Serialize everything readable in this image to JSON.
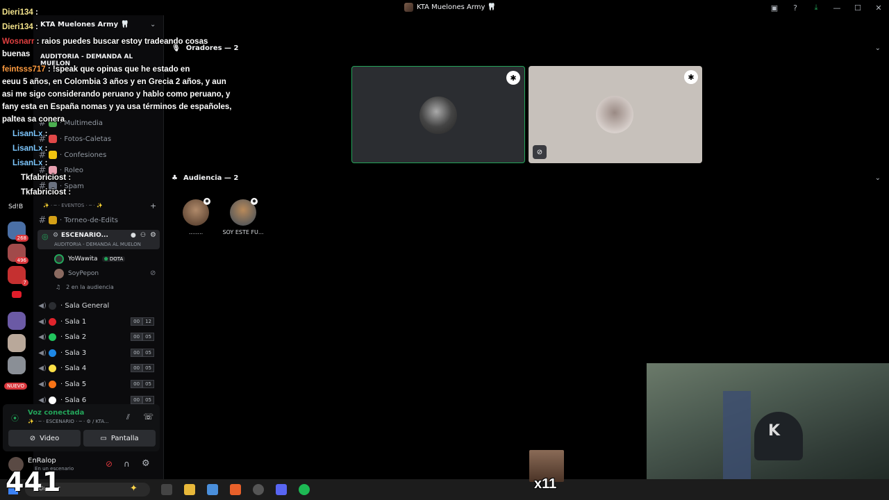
{
  "window": {
    "title": "KTA Muelones Army 🦷"
  },
  "server": {
    "name": "KTA Muelones Army 🦷"
  },
  "stage_topic_overlay": "AUDITORIA - DEMANDA AL MUELON",
  "channels": [
    {
      "name": "· Multimedia"
    },
    {
      "name": "· Fotos-Caletas"
    },
    {
      "name": "· Confesiones"
    },
    {
      "name": "· Roleo"
    },
    {
      "name": "· Spam"
    }
  ],
  "events_category": "✨ · ─ · EVENTOS · ─ · ✨",
  "torneo": "· Torneo-de-Edits",
  "stage_channel": {
    "name": "ESCENARIO...",
    "topic": "AUDITORIA - DEMANDA AL MUELON",
    "speakers": [
      {
        "name": "YoWawita",
        "tag": "DOTA"
      },
      {
        "name": "SoyPepon"
      }
    ],
    "audience_text": "2 en la audiencia"
  },
  "voice_channels": [
    {
      "name": "· Sala General",
      "color": "#2b2d31",
      "counts": null
    },
    {
      "name": "· Sala 1",
      "color": "#e0242c",
      "counts": [
        "00",
        "12"
      ]
    },
    {
      "name": "· Sala 2",
      "color": "#22c55e",
      "counts": [
        "00",
        "05"
      ]
    },
    {
      "name": "· Sala 3",
      "color": "#1e88e5",
      "counts": [
        "00",
        "05"
      ]
    },
    {
      "name": "· Sala 4",
      "color": "#fde047",
      "counts": [
        "00",
        "05"
      ]
    },
    {
      "name": "· Sala 5",
      "color": "#f97316",
      "counts": [
        "00",
        "05"
      ]
    },
    {
      "name": "· Sala 6",
      "color": "#ffffff",
      "counts": [
        "00",
        "05"
      ]
    }
  ],
  "voice_panel": {
    "status": "Voz conectada",
    "channel": "✨ · ─ · ESCENARIO · ─ · ⚙ / KTA...",
    "video_label": "Video",
    "screen_label": "Pantalla"
  },
  "user": {
    "name": "EnRalop",
    "status": "En un escenario"
  },
  "rail": {
    "label": "Sd!B",
    "badges": [
      "268",
      "496",
      "7"
    ],
    "new_label": "NUEVO"
  },
  "main": {
    "speakers_header": "Oradores — 2",
    "audience_header": "Audiencia — 2",
    "audience": [
      {
        "name": "........"
      },
      {
        "name": "SOY ESTE FU..."
      }
    ]
  },
  "chat": [
    {
      "user": "Dieri134",
      "text": "",
      "user_color": "yellow"
    },
    {
      "user": "Dieri134",
      "text": "",
      "user_color": "yellow"
    },
    {
      "user": "Wosnarr",
      "text": "raios puedes buscar estoy tradeando cosas",
      "user_color": "yellow"
    },
    {
      "user": "",
      "text": "buenas",
      "user_color": "white"
    },
    {
      "user": "feintsss717",
      "text": "!speak que opinas que he estado en",
      "user_color": "yellow"
    },
    {
      "user": "",
      "text": "eeuu 5 años, en Colombia 3 años y en Grecia 2 años, y aun",
      "user_color": "white"
    },
    {
      "user": "",
      "text": "asi me sigo considerando peruano y hablo como peruano, y",
      "user_color": "white"
    },
    {
      "user": "",
      "text": "fany esta en España nomas y ya usa términos de españoles,",
      "user_color": "white"
    },
    {
      "user": "",
      "text": "paltea sa conera",
      "user_color": "white"
    },
    {
      "user": "LisanLx",
      "text": "",
      "user_color": "blue"
    },
    {
      "user": "LisanLx",
      "text": "",
      "user_color": "blue"
    },
    {
      "user": "LisanLx",
      "text": "",
      "user_color": "blue"
    },
    {
      "user": "Tkfabriciost",
      "text": "",
      "user_color": "white"
    },
    {
      "user": "Tkfabriciost",
      "text": "",
      "user_color": "white"
    }
  ],
  "overlay": {
    "big_count": "441",
    "emote_count": "x11"
  },
  "taskbar": {
    "search_placeholder": "Buscar"
  }
}
